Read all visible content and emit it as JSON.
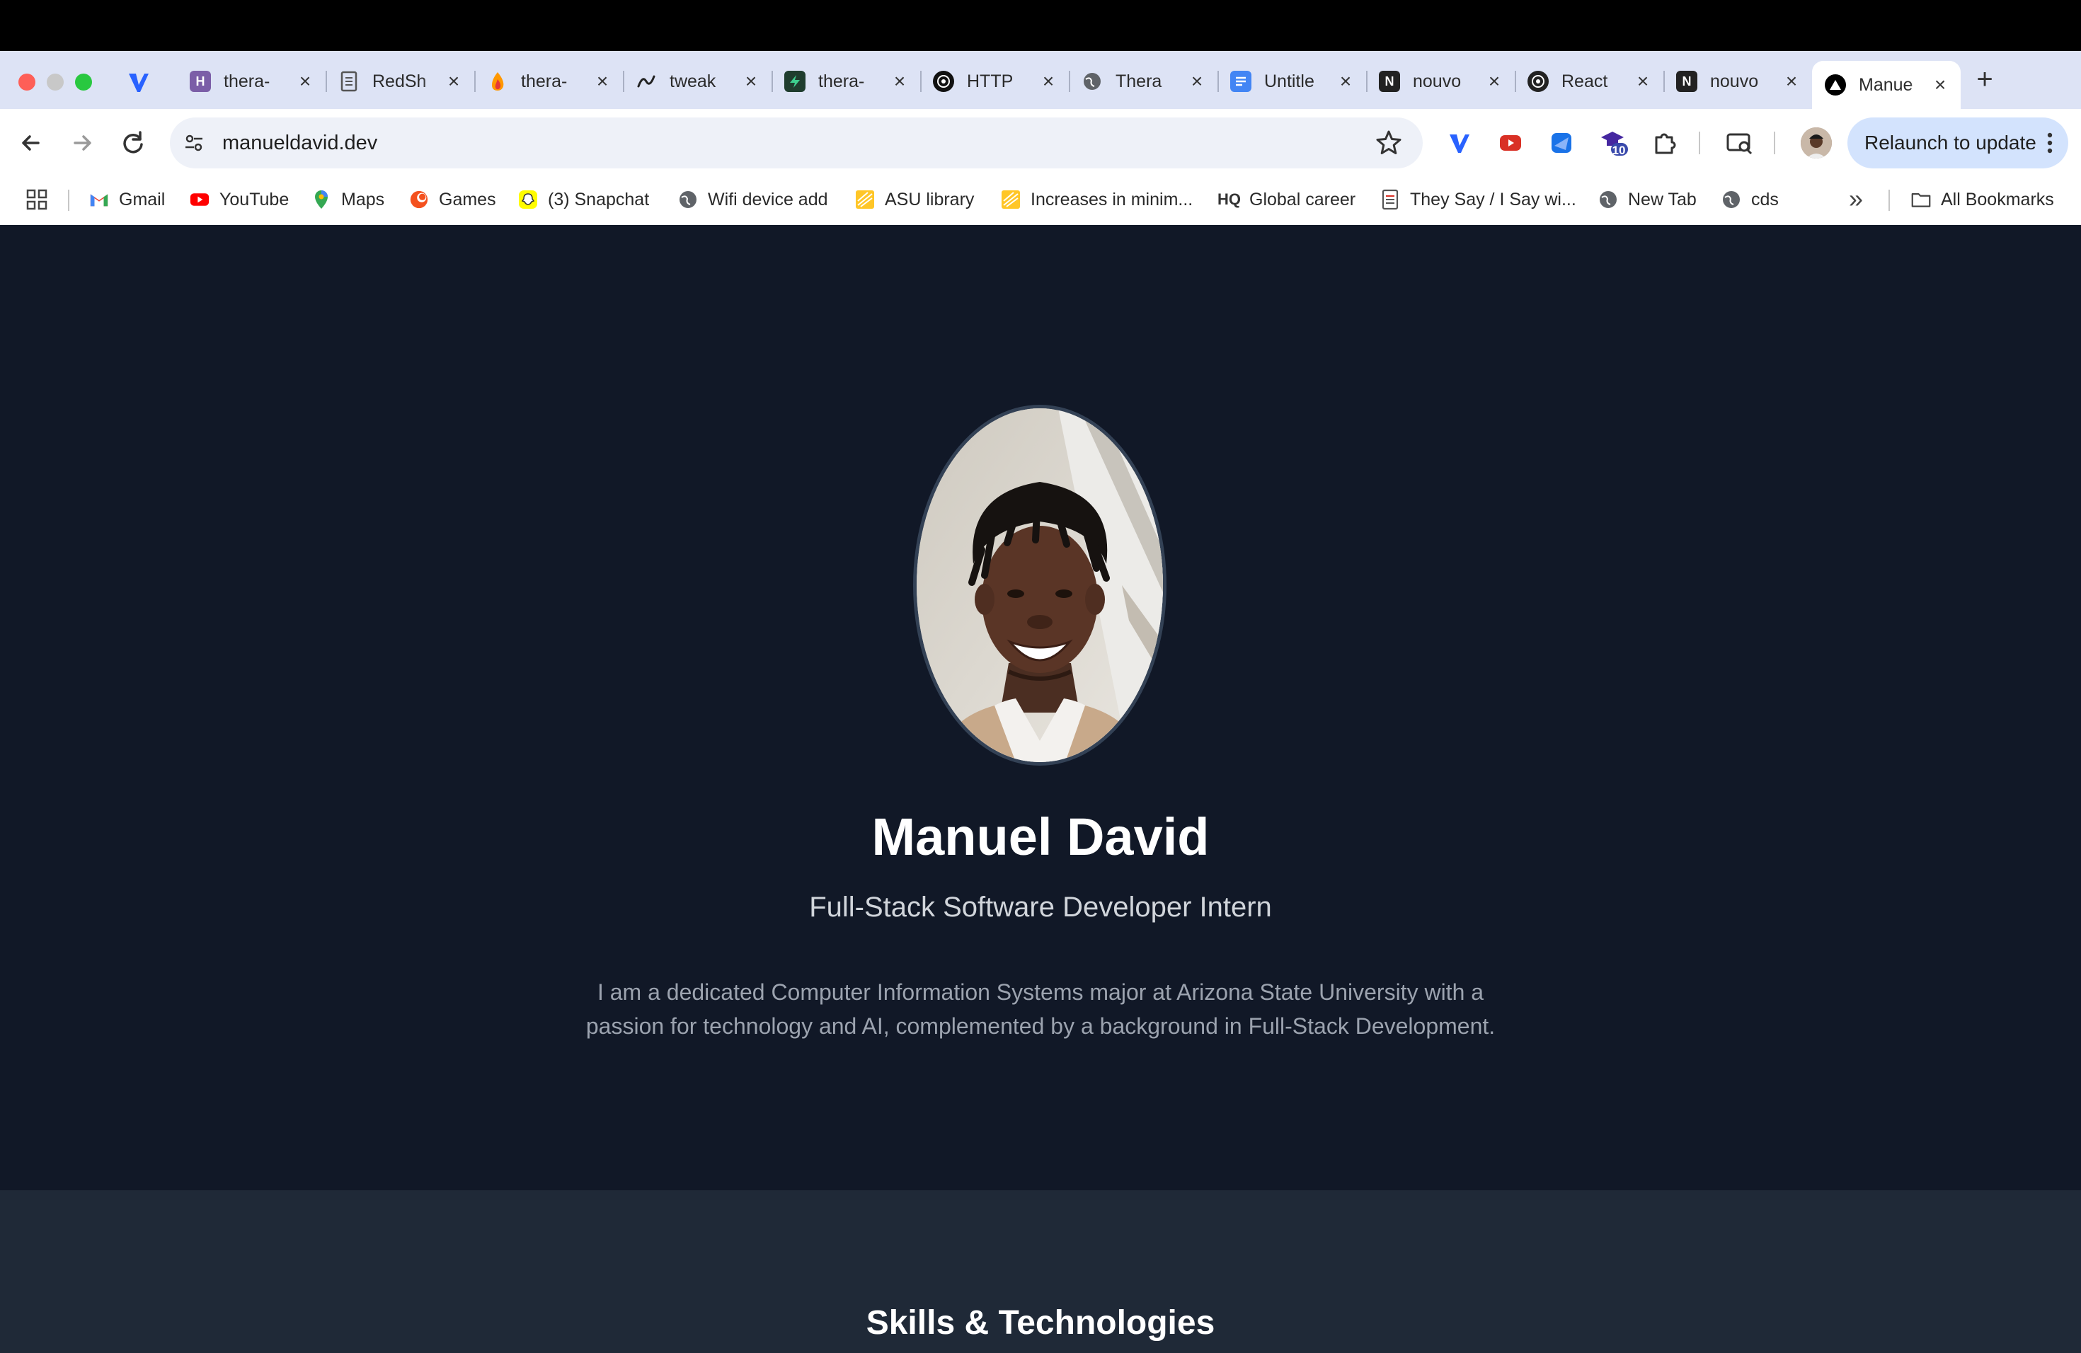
{
  "browser": {
    "tabs": [
      {
        "title": "thera-",
        "icon": "heroku-icon",
        "color": "#7b5ea7",
        "letter": "H"
      },
      {
        "title": "RedSh",
        "icon": "document-icon",
        "color": "#555555",
        "letter": ""
      },
      {
        "title": "thera-",
        "icon": "firebase-icon",
        "color": "#f57c00",
        "letter": ""
      },
      {
        "title": "tweak",
        "icon": "tweakcn-icon",
        "color": "#222222",
        "letter": ""
      },
      {
        "title": "thera-",
        "icon": "supabase-icon",
        "color": "#1f3d2e",
        "letter": ""
      },
      {
        "title": "HTTP",
        "icon": "openai-icon",
        "color": "#111111",
        "letter": ""
      },
      {
        "title": "Thera",
        "icon": "globe-icon",
        "color": "#555555",
        "letter": ""
      },
      {
        "title": "Untitle",
        "icon": "google-docs-icon",
        "color": "#4285f4",
        "letter": ""
      },
      {
        "title": "nouvo",
        "icon": "notion-icon",
        "color": "#222222",
        "letter": "N"
      },
      {
        "title": "React",
        "icon": "react-icon",
        "color": "#222222",
        "letter": ""
      },
      {
        "title": "nouvo",
        "icon": "notion-icon",
        "color": "#222222",
        "letter": "N"
      },
      {
        "title": "Manue",
        "icon": "vercel-icon",
        "color": "#000000",
        "letter": "",
        "active": true
      }
    ],
    "url": "manueldavid.dev",
    "relaunch_label": "Relaunch to update",
    "extension_badge": "10",
    "bookmarks": [
      {
        "label": "Gmail",
        "icon": "gmail-icon"
      },
      {
        "label": "YouTube",
        "icon": "youtube-icon"
      },
      {
        "label": "Maps",
        "icon": "maps-icon"
      },
      {
        "label": "Games",
        "icon": "games-icon"
      },
      {
        "label": "(3) Snapchat",
        "icon": "snapchat-icon"
      },
      {
        "label": "Wifi device add",
        "icon": "globe-icon"
      },
      {
        "label": "ASU library",
        "icon": "asu-icon"
      },
      {
        "label": "Increases in minim...",
        "icon": "asu-icon"
      },
      {
        "label": "Global career",
        "icon": "hq-icon"
      },
      {
        "label": "They Say / I Say wi...",
        "icon": "document-icon"
      },
      {
        "label": "New Tab",
        "icon": "globe-icon"
      },
      {
        "label": "cds",
        "icon": "globe-icon"
      }
    ],
    "hq_text": "HQ",
    "all_bookmarks_label": "All Bookmarks",
    "overflow_glyph": "»"
  },
  "profile": {
    "name": "Manuel David",
    "role": "Full-Stack Software Developer Intern",
    "bio": "I am a dedicated Computer Information Systems major at Arizona State University with a passion for technology and AI, complemented by a background in Full-Stack Development."
  },
  "skills": {
    "title": "Skills & Technologies"
  }
}
